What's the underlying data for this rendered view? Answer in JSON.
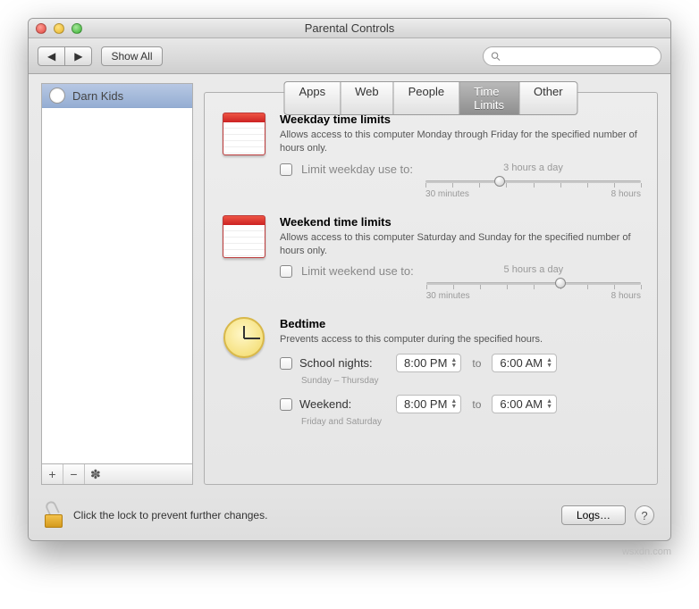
{
  "window": {
    "title": "Parental Controls"
  },
  "toolbar": {
    "back_icon": "◀",
    "forward_icon": "▶",
    "show_all": "Show All",
    "search_placeholder": ""
  },
  "sidebar": {
    "users": [
      {
        "name": "Darn Kids"
      }
    ],
    "add_icon": "+",
    "remove_icon": "−",
    "action_icon": "✽"
  },
  "tabs": [
    {
      "label": "Apps"
    },
    {
      "label": "Web"
    },
    {
      "label": "People"
    },
    {
      "label": "Time Limits",
      "active": true
    },
    {
      "label": "Other"
    }
  ],
  "sections": {
    "weekday": {
      "title": "Weekday time limits",
      "desc": "Allows access to this computer Monday through Friday for the specified number of hours only.",
      "checkbox_label": "Limit weekday use to:",
      "slider_value": "3 hours a day",
      "slider_min": "30 minutes",
      "slider_max": "8 hours",
      "knob_pct": 32
    },
    "weekend": {
      "title": "Weekend time limits",
      "desc": "Allows access to this computer Saturday and Sunday for the specified number of hours only.",
      "checkbox_label": "Limit weekend use to:",
      "slider_value": "5 hours a day",
      "slider_min": "30 minutes",
      "slider_max": "8 hours",
      "knob_pct": 60
    },
    "bedtime": {
      "title": "Bedtime",
      "desc": "Prevents access to this computer during the specified hours.",
      "rows": [
        {
          "label": "School nights:",
          "note": "Sunday – Thursday",
          "from": "8:00 PM",
          "to_word": "to",
          "to": "6:00 AM"
        },
        {
          "label": "Weekend:",
          "note": "Friday and Saturday",
          "from": "8:00 PM",
          "to_word": "to",
          "to": "6:00 AM"
        }
      ]
    }
  },
  "footer": {
    "lock_text": "Click the lock to prevent further changes.",
    "logs": "Logs…",
    "help": "?"
  },
  "watermark": "wsxdn.com"
}
